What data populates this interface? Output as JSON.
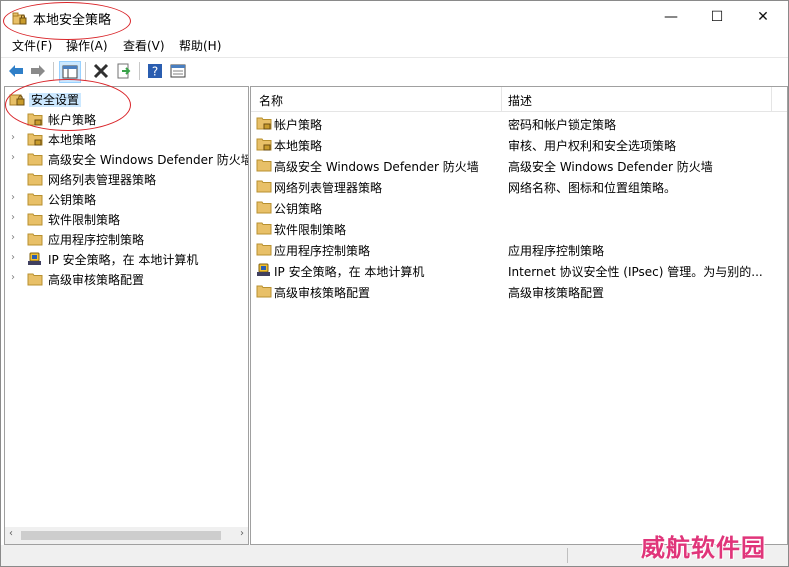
{
  "window": {
    "title": "本地安全策略",
    "controls": {
      "minimize": "—",
      "maximize": "☐",
      "close": "✕"
    }
  },
  "menubar": {
    "items": [
      {
        "label": "文件(F)"
      },
      {
        "label": "操作(A)"
      },
      {
        "label": "查看(V)"
      },
      {
        "label": "帮助(H)"
      }
    ]
  },
  "toolbar": {
    "icons": [
      "back-arrow-icon",
      "forward-arrow-icon",
      "console-tree-icon",
      "delete-x-icon",
      "export-list-icon",
      "help-icon",
      "properties-icon"
    ],
    "colors": {
      "arrows": "#2f7fc8",
      "delete": "#303030",
      "help": "#2a5db0"
    }
  },
  "tree": {
    "root": {
      "label": "安全设置",
      "icon": "security-settings-icon",
      "selected": true
    },
    "items": [
      {
        "label": "帐户策略",
        "icon": "folder-lock-icon",
        "expandable": false
      },
      {
        "label": "本地策略",
        "icon": "folder-lock-icon",
        "expandable": true
      },
      {
        "label": "高级安全 Windows Defender 防火墙",
        "icon": "folder-icon",
        "expandable": true
      },
      {
        "label": "网络列表管理器策略",
        "icon": "folder-icon",
        "expandable": false
      },
      {
        "label": "公钥策略",
        "icon": "folder-icon",
        "expandable": true
      },
      {
        "label": "软件限制策略",
        "icon": "folder-icon",
        "expandable": true
      },
      {
        "label": "应用程序控制策略",
        "icon": "folder-icon",
        "expandable": true
      },
      {
        "label": "IP 安全策略，在 本地计算机",
        "icon": "ip-security-icon",
        "expandable": true
      },
      {
        "label": "高级审核策略配置",
        "icon": "folder-icon",
        "expandable": true
      }
    ],
    "scroll_left": "‹",
    "scroll_right": "›"
  },
  "list": {
    "columns": {
      "name": "名称",
      "description": "描述"
    },
    "rows": [
      {
        "name": "帐户策略",
        "description": "密码和帐户锁定策略",
        "icon": "folder-lock-icon"
      },
      {
        "name": "本地策略",
        "description": "审核、用户权利和安全选项策略",
        "icon": "folder-lock-icon"
      },
      {
        "name": "高级安全 Windows Defender 防火墙",
        "description": "高级安全 Windows Defender 防火墙",
        "icon": "folder-icon"
      },
      {
        "name": "网络列表管理器策略",
        "description": "网络名称、图标和位置组策略。",
        "icon": "folder-icon"
      },
      {
        "name": "公钥策略",
        "description": "",
        "icon": "folder-icon"
      },
      {
        "name": "软件限制策略",
        "description": "",
        "icon": "folder-icon"
      },
      {
        "name": "应用程序控制策略",
        "description": "应用程序控制策略",
        "icon": "folder-icon"
      },
      {
        "name": "IP 安全策略，在 本地计算机",
        "description": "Internet 协议安全性 (IPsec) 管理。为与别的...",
        "icon": "ip-security-icon"
      },
      {
        "name": "高级审核策略配置",
        "description": "高级审核策略配置",
        "icon": "folder-icon"
      }
    ]
  },
  "watermark": "威航软件园",
  "colors": {
    "folder": "#e8c068",
    "selection": "#cce8ff",
    "annotation_circle": "#d9252a",
    "watermark": "#e0357a"
  }
}
